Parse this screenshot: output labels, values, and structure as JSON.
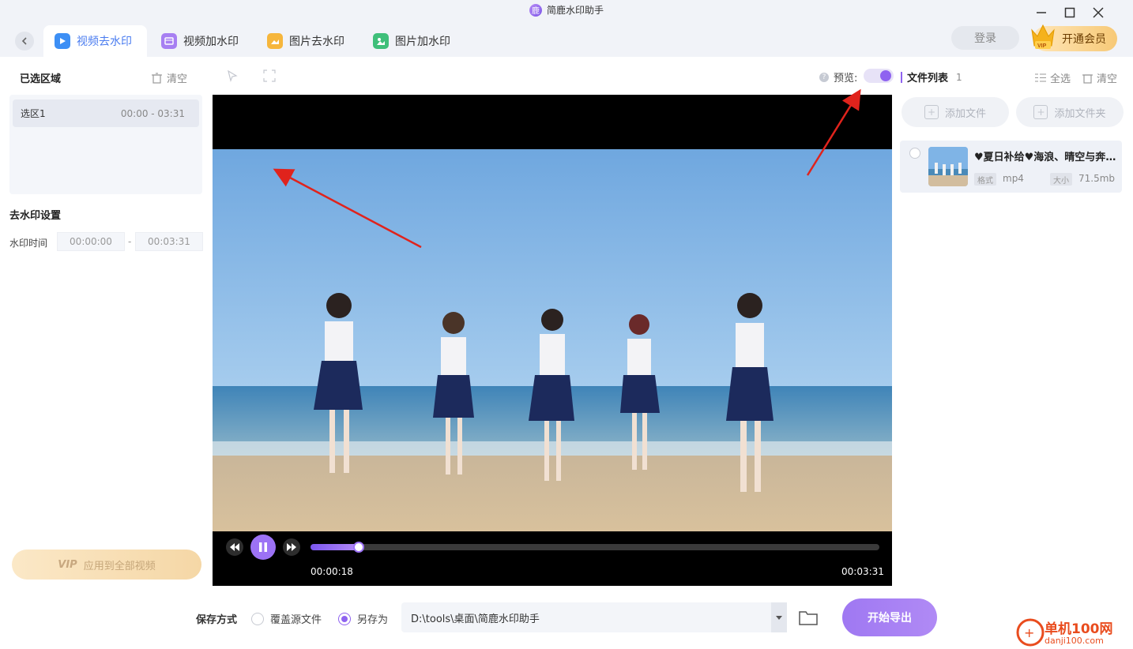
{
  "window": {
    "title": "简鹿水印助手",
    "logo_glyph": "鹿"
  },
  "tabs": [
    {
      "label": "视频去水印",
      "icon": "video-remove-icon",
      "active": true
    },
    {
      "label": "视频加水印",
      "icon": "video-add-icon",
      "active": false
    },
    {
      "label": "图片去水印",
      "icon": "image-remove-icon",
      "active": false
    },
    {
      "label": "图片加水印",
      "icon": "image-add-icon",
      "active": false
    }
  ],
  "header": {
    "login_label": "登录",
    "vip_label": "开通会员",
    "vip_badge": "VIP"
  },
  "left_panel": {
    "selected_region_title": "已选区域",
    "clear_label": "清空",
    "regions": [
      {
        "name": "选区1",
        "range": "00:00 - 03:31"
      }
    ],
    "settings_title": "去水印设置",
    "watermark_time_label": "水印时间",
    "time_start": "00:00:00",
    "time_sep": "-",
    "time_end": "00:03:31",
    "apply_all_vip": "VIP",
    "apply_all_label": "应用到全部视频"
  },
  "preview": {
    "label": "预览:",
    "enabled": true
  },
  "player": {
    "current_time": "00:00:18",
    "total_time": "00:03:31",
    "progress": 0.085,
    "playing": true
  },
  "file_list": {
    "title": "文件列表",
    "count": "1",
    "select_all_label": "全选",
    "clear_label": "清空",
    "add_file_label": "添加文件",
    "add_folder_label": "添加文件夹",
    "files": [
      {
        "name": "♥夏日补给♥海浪、晴空与奔跑的少女",
        "format_tag": "格式",
        "format": "mp4",
        "size_tag": "大小",
        "size": "71.5mb"
      }
    ]
  },
  "bottom": {
    "save_mode_label": "保存方式",
    "overwrite_label": "覆盖源文件",
    "save_as_label": "另存为",
    "selected": "save_as",
    "path": "D:\\tools\\桌面\\简鹿水印助手",
    "export_label": "开始导出"
  },
  "watermark": {
    "cn": "单机100网",
    "en": "danji100.com"
  },
  "colors": {
    "accent": "#8f63f0",
    "tab_active": "#4a7cf0",
    "annotation_arrow": "#e0231c"
  }
}
